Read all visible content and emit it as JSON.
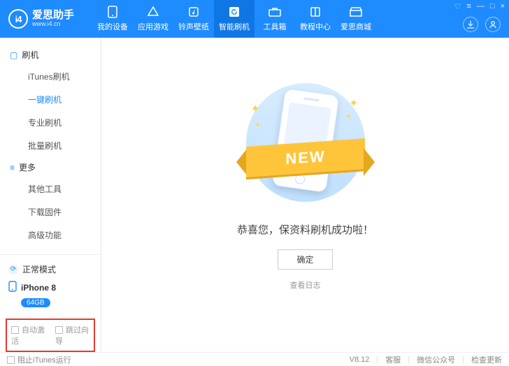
{
  "brand": {
    "cn": "爱思助手",
    "url": "www.i4.cn",
    "logo_text": "i4"
  },
  "nav": [
    {
      "label": "我的设备",
      "icon": "phone"
    },
    {
      "label": "应用游戏",
      "icon": "apps"
    },
    {
      "label": "铃声壁纸",
      "icon": "music"
    },
    {
      "label": "智能刷机",
      "icon": "refresh",
      "active": true
    },
    {
      "label": "工具箱",
      "icon": "toolbox"
    },
    {
      "label": "教程中心",
      "icon": "book"
    },
    {
      "label": "爱思商城",
      "icon": "store"
    }
  ],
  "window_controls": [
    "♡",
    "≡",
    "—",
    "□",
    "×"
  ],
  "circle_buttons": [
    "download",
    "user"
  ],
  "sidebar": {
    "sections": [
      {
        "title": "刷机",
        "icon": "▢",
        "items": [
          "iTunes刷机",
          "一键刷机",
          "专业刷机",
          "批量刷机"
        ],
        "active_index": 1
      },
      {
        "title": "更多",
        "icon": "≡",
        "items": [
          "其他工具",
          "下载固件",
          "高级功能"
        ],
        "active_index": -1
      }
    ],
    "mode_label": "正常模式",
    "device_name": "iPhone 8",
    "device_storage": "64GB",
    "redbox": {
      "opt1": "自动激活",
      "opt2": "跳过向导"
    }
  },
  "main": {
    "ribbon_text": "NEW",
    "success_text": "恭喜您，保资料刷机成功啦！",
    "ok_button": "确定",
    "view_log": "查看日志"
  },
  "footer": {
    "block_itunes": "阻止iTunes运行",
    "version": "V8.12",
    "links": [
      "客服",
      "微信公众号",
      "检查更新"
    ]
  }
}
